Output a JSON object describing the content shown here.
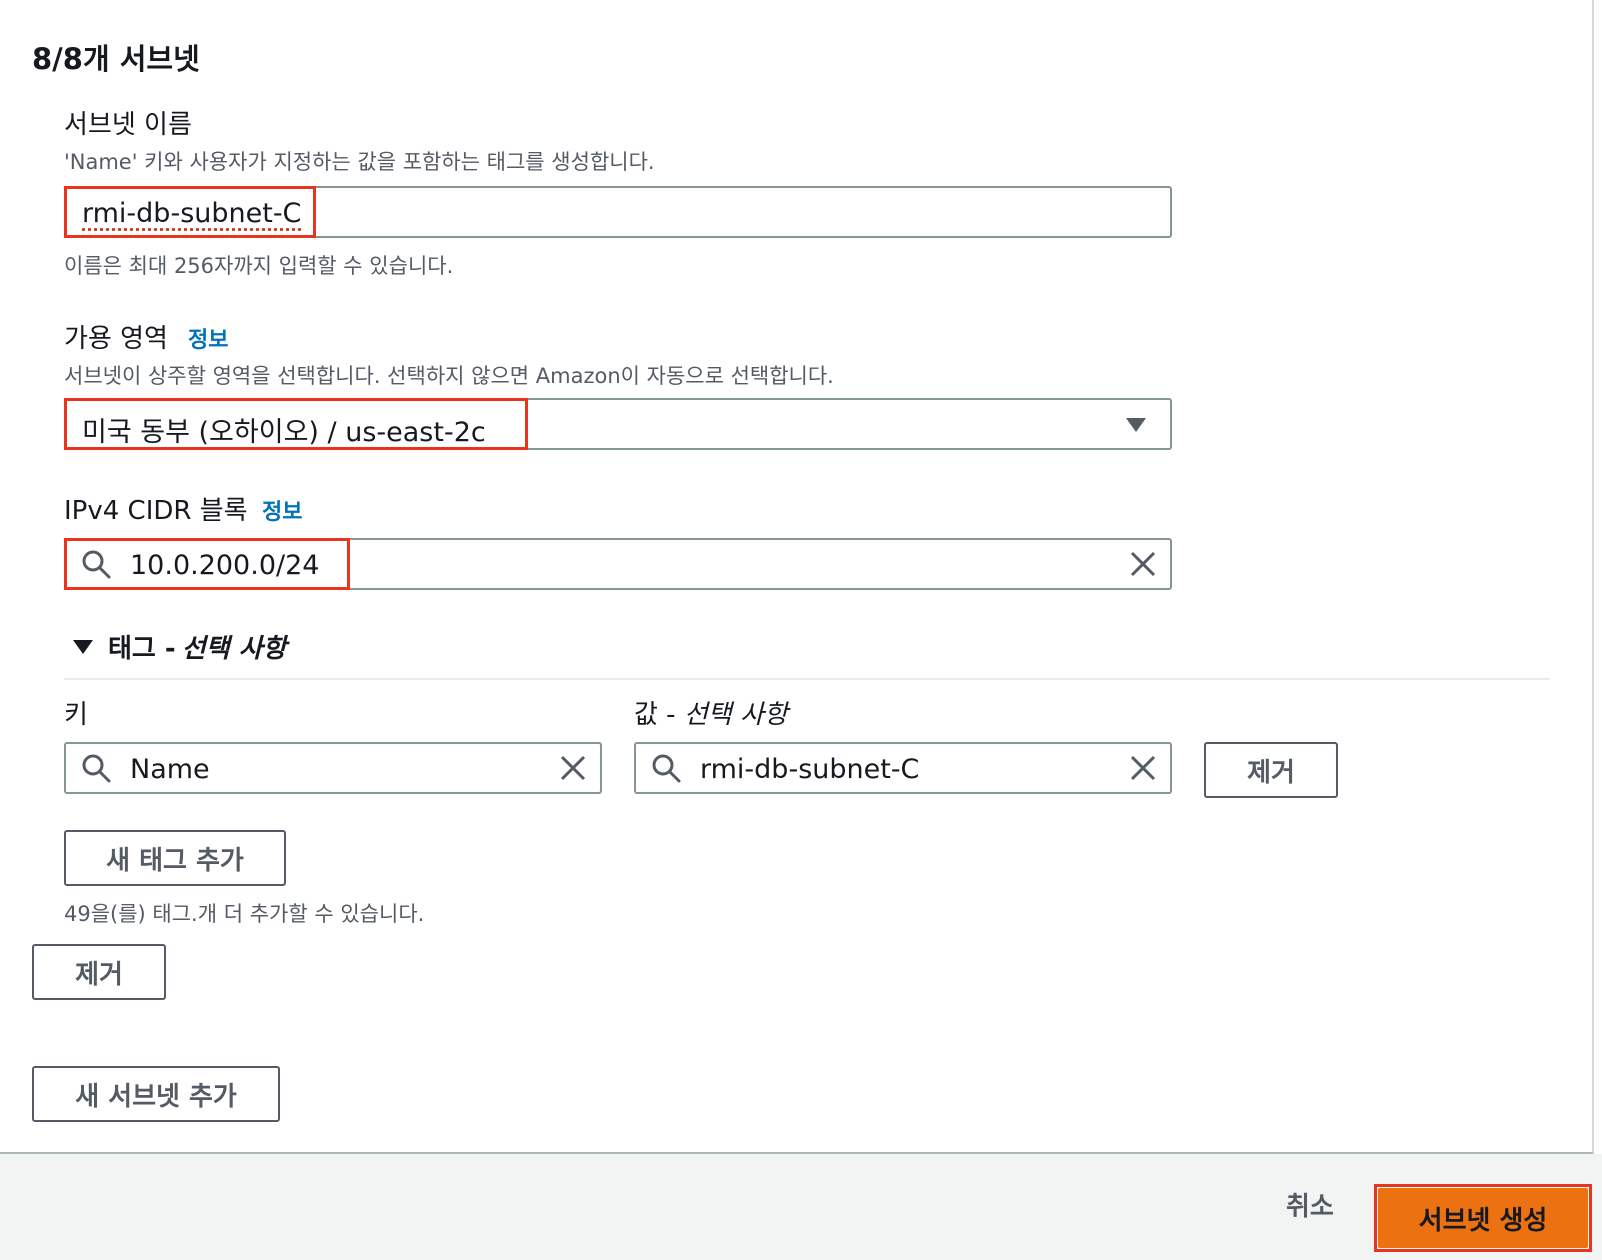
{
  "section": {
    "title": "8/8개 서브넷"
  },
  "subnet_name": {
    "label": "서브넷 이름",
    "description": "'Name' 키와 사용자가 지정하는 값을 포함하는 태그를 생성합니다.",
    "value": "rmi-db-subnet-C",
    "constraint": "이름은 최대 256자까지 입력할 수 있습니다."
  },
  "availability_zone": {
    "label": "가용 영역",
    "info": "정보",
    "description": "서브넷이 상주할 영역을 선택합니다. 선택하지 않으면 Amazon이 자동으로 선택합니다.",
    "selected": "미국 동부 (오하이오) / us-east-2c"
  },
  "ipv4_cidr": {
    "label": "IPv4 CIDR 블록",
    "info": "정보",
    "value": "10.0.200.0/24"
  },
  "tags": {
    "header": "태그 - ",
    "header_optional": "선택 사항",
    "key_label": "키",
    "value_label": "값 - ",
    "value_label_optional": "선택 사항",
    "rows": [
      {
        "key": "Name",
        "value": "rmi-db-subnet-C",
        "remove_label": "제거"
      }
    ],
    "add_label": "새 태그 추가",
    "remaining": "49을(를) 태그.개 더 추가할 수 있습니다."
  },
  "remove_subnet_label": "제거",
  "add_subnet_label": "새 서브넷 추가",
  "footer": {
    "cancel_label": "취소",
    "create_label": "서브넷 생성"
  },
  "colors": {
    "accent": "#ff9900",
    "highlight": "#e8351d",
    "link": "#0073bb"
  },
  "icons": [
    "search-icon",
    "close-icon",
    "caret-down-icon",
    "expand-caret-icon"
  ]
}
